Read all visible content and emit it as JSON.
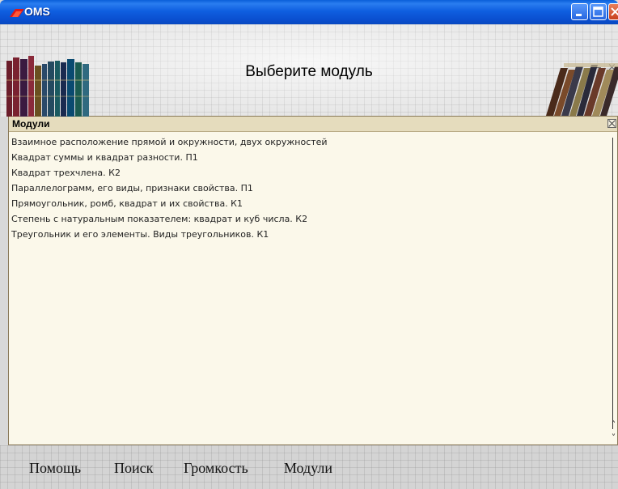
{
  "window": {
    "title": "OMS",
    "minimize_icon": "minimize-icon",
    "maximize_icon": "maximize-icon",
    "close_icon": "close-icon"
  },
  "header": {
    "title": "Выберите модуль",
    "mini_minimize": "–",
    "mini_close": "×"
  },
  "modules": {
    "title": "Модули",
    "items": [
      "Взаимное расположение прямой и окружности, двух окружностей",
      "Квадрат суммы и квадрат разности. П1",
      "Квадрат трехчлена. К2",
      "Параллелограмм, его виды, признаки свойства. П1",
      "Прямоугольник, ромб, квадрат и их свойства. К1",
      "Степень с натуральным показателем: квадрат и куб числа. К2",
      "Треугольник и его элементы. Виды треугольников. К1"
    ],
    "scroll_up": "˄",
    "scroll_down": "˅"
  },
  "footer": {
    "help": "Помощь",
    "search": "Поиск",
    "volume": "Громкость",
    "modules": "Модули"
  },
  "colors": {
    "titlebar": "#0a5fd8",
    "panel_bg": "#fbf8ea",
    "panel_header": "#e5dcbd"
  }
}
